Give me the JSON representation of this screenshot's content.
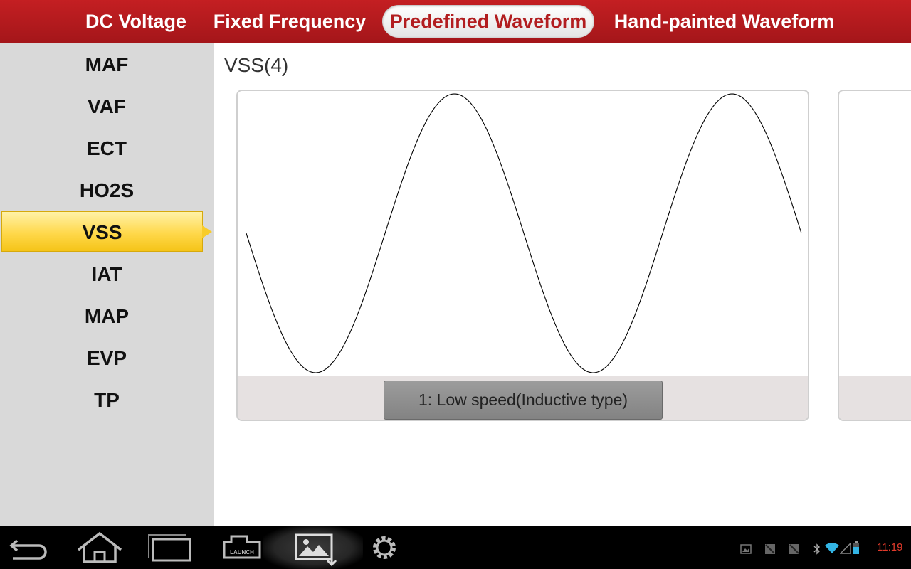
{
  "tabs": [
    {
      "label": "DC Voltage",
      "active": false
    },
    {
      "label": "Fixed Frequency",
      "active": false
    },
    {
      "label": "Predefined Waveform",
      "active": true
    },
    {
      "label": "Hand-painted Waveform",
      "active": false
    }
  ],
  "sidebar": {
    "items": [
      {
        "label": "MAF"
      },
      {
        "label": "VAF"
      },
      {
        "label": "ECT"
      },
      {
        "label": "HO2S"
      },
      {
        "label": "VSS",
        "selected": true
      },
      {
        "label": "IAT"
      },
      {
        "label": "MAP"
      },
      {
        "label": "EVP"
      },
      {
        "label": "TP"
      }
    ]
  },
  "main": {
    "title": "VSS(4)",
    "cards": [
      {
        "button_label": "1: Low speed(Inductive type)",
        "waveform": "sine"
      }
    ]
  },
  "navbar": {
    "buttons": [
      "back-icon",
      "home-icon",
      "recent-apps-icon",
      "launch-icon",
      "screenshot-icon",
      "settings-icon"
    ],
    "clock": "11:19"
  },
  "colors": {
    "accent": "#b21d1f",
    "selection": "#ffd84a",
    "clock": "#e03a2b"
  }
}
